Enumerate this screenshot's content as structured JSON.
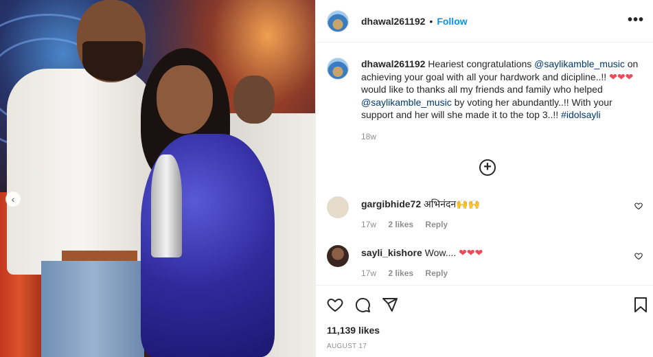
{
  "post": {
    "username": "dhawal261192",
    "separator": "•",
    "follow_label": "Follow",
    "more_label": "•••"
  },
  "caption": {
    "username": "dhawal261192",
    "part1": " Heariest congratulations ",
    "mention1": "@saylikamble_music",
    "part2": " on achieving your goal with all your hardwork and dicipline..!! ",
    "hearts1": "❤❤❤",
    "part3": " would like to thanks all my friends and family who helped ",
    "mention2": "@saylikamble_music",
    "part4": " by voting her abundantly..!! With your support and her will she made it to the top 3..!! ",
    "hashtag": "#idolsayli",
    "time": "18w"
  },
  "load_more_icon": "plus-circle-icon",
  "comments": [
    {
      "username": "gargibhide72",
      "text": " अभिनंदन🙌🙌",
      "time": "17w",
      "likes": "2 likes",
      "reply": "Reply",
      "avatar_color": "#e6dccb"
    },
    {
      "username": "sayli_kishore",
      "text": " Wow.... ",
      "hearts": "❤❤❤",
      "time": "17w",
      "likes": "2 likes",
      "reply": "Reply",
      "avatar_color": "#6b4a3a"
    }
  ],
  "actions": {
    "icons": [
      "heart-icon",
      "comment-icon",
      "share-icon",
      "bookmark-icon"
    ],
    "likes": "11,139 likes",
    "date": "AUGUST 17"
  },
  "colors": {
    "link": "#00376b",
    "follow": "#0095f6",
    "heart": "#ed4956",
    "muted": "#8e8e8e"
  }
}
